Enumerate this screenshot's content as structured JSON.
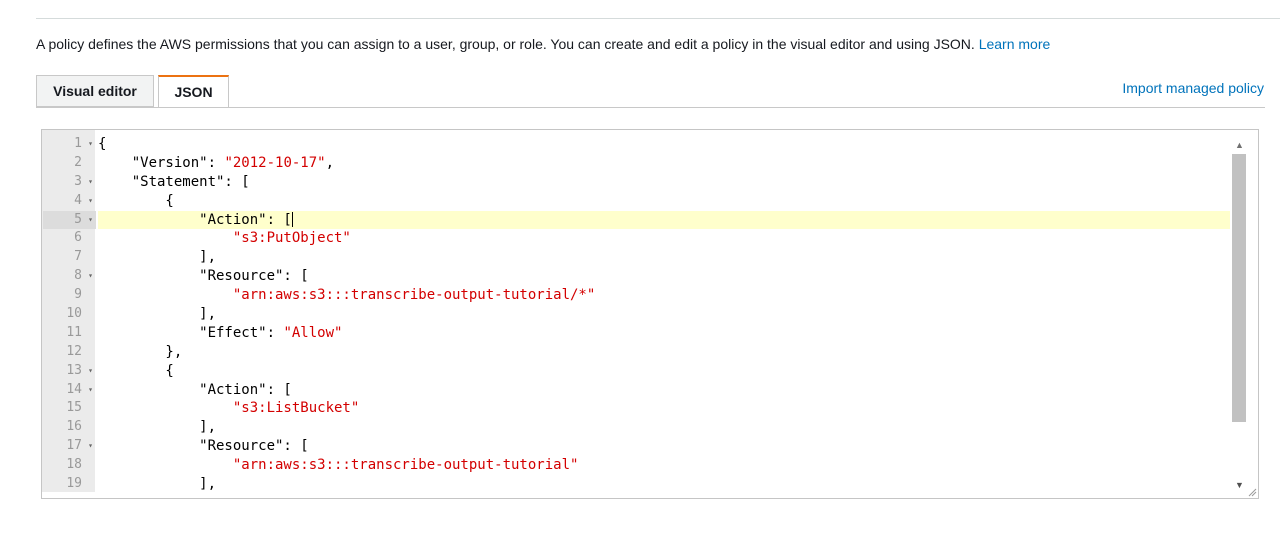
{
  "intro": {
    "text": "A policy defines the AWS permissions that you can assign to a user, group, or role. You can create and edit a policy in the visual editor and using JSON. ",
    "learn_more": "Learn more"
  },
  "tabs": [
    {
      "label": "Visual editor",
      "active": false
    },
    {
      "label": "JSON",
      "active": true
    }
  ],
  "import_link": "Import managed policy",
  "editor": {
    "active_line": 5,
    "lines": [
      {
        "n": "1",
        "fold": true
      },
      {
        "n": "2",
        "fold": false
      },
      {
        "n": "3",
        "fold": true
      },
      {
        "n": "4",
        "fold": true
      },
      {
        "n": "5",
        "fold": true
      },
      {
        "n": "6",
        "fold": false
      },
      {
        "n": "7",
        "fold": false
      },
      {
        "n": "8",
        "fold": true
      },
      {
        "n": "9",
        "fold": false
      },
      {
        "n": "10",
        "fold": false
      },
      {
        "n": "11",
        "fold": false
      },
      {
        "n": "12",
        "fold": false
      },
      {
        "n": "13",
        "fold": true
      },
      {
        "n": "14",
        "fold": true
      },
      {
        "n": "15",
        "fold": false
      },
      {
        "n": "16",
        "fold": false
      },
      {
        "n": "17",
        "fold": true
      },
      {
        "n": "18",
        "fold": false
      },
      {
        "n": "19",
        "fold": false
      }
    ],
    "code": [
      {
        "pre": "{",
        "str": "",
        "post": ""
      },
      {
        "pre": "    \"Version\": ",
        "str": "\"2012-10-17\"",
        "post": ","
      },
      {
        "pre": "    \"Statement\": [",
        "str": "",
        "post": ""
      },
      {
        "pre": "        {",
        "str": "",
        "post": ""
      },
      {
        "pre": "            \"Action\": [",
        "str": "",
        "post": ""
      },
      {
        "pre": "                ",
        "str": "\"s3:PutObject\"",
        "post": ""
      },
      {
        "pre": "            ],",
        "str": "",
        "post": ""
      },
      {
        "pre": "            \"Resource\": [",
        "str": "",
        "post": ""
      },
      {
        "pre": "                ",
        "str": "\"arn:aws:s3:::transcribe-output-tutorial/*\"",
        "post": ""
      },
      {
        "pre": "            ],",
        "str": "",
        "post": ""
      },
      {
        "pre": "            \"Effect\": ",
        "str": "\"Allow\"",
        "post": ""
      },
      {
        "pre": "        },",
        "str": "",
        "post": ""
      },
      {
        "pre": "        {",
        "str": "",
        "post": ""
      },
      {
        "pre": "            \"Action\": [",
        "str": "",
        "post": ""
      },
      {
        "pre": "                ",
        "str": "\"s3:ListBucket\"",
        "post": ""
      },
      {
        "pre": "            ],",
        "str": "",
        "post": ""
      },
      {
        "pre": "            \"Resource\": [",
        "str": "",
        "post": ""
      },
      {
        "pre": "                ",
        "str": "\"arn:aws:s3:::transcribe-output-tutorial\"",
        "post": ""
      },
      {
        "pre": "            ],",
        "str": "",
        "post": ""
      }
    ]
  },
  "icons": {
    "fold": "fold-arrow-icon",
    "scroll_up": "scroll-up-arrow-icon",
    "scroll_down": "scroll-down-arrow-icon",
    "resize": "resize-grip-icon"
  },
  "colors": {
    "link": "#0073bb",
    "active_tab_accent": "#ec7211",
    "string": "#d30000",
    "active_line": "#ffffcc"
  }
}
